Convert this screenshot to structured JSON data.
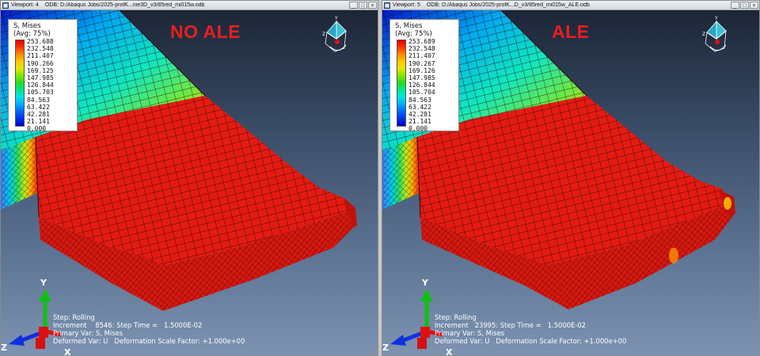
{
  "viewports": [
    {
      "title": "Viewport: 4",
      "odb": "ODB: D:/Abaqus Jobs/2025-profK...nie3D_v3/85red_mi015w.odb",
      "overlay_label": "NO ALE",
      "legend": {
        "title": "S, Mises",
        "avg": "(Avg: 75%)",
        "values": [
          "253.688",
          "232.548",
          "211.407",
          "190.266",
          "169.125",
          "147.985",
          "126.844",
          "105.703",
          "84.563",
          "63.422",
          "42.281",
          "21.141",
          "0.000"
        ]
      },
      "info": {
        "step": "Step: Rolling",
        "increment": "Increment    8546: Step Time =   1.5000E-02",
        "primary_var": "Primary Var: S, Mises",
        "deformed_var": "Deformed Var: U   Deformation Scale Factor: +1.000e+00"
      }
    },
    {
      "title": "Viewport: 5",
      "odb": "ODB: D:/Abaqus Jobs/2025-profK...D_v3/85red_mi015w_ALE.odb",
      "overlay_label": "ALE",
      "legend": {
        "title": "S, Mises",
        "avg": "(Avg: 75%)",
        "values": [
          "253.689",
          "232.548",
          "211.407",
          "190.267",
          "169.126",
          "147.985",
          "126.844",
          "105.704",
          "84.563",
          "63.422",
          "42.281",
          "21.141",
          "0.000"
        ]
      },
      "info": {
        "step": "Step: Rolling",
        "increment": "Increment   23995: Step Time =   1.5000E-02",
        "primary_var": "Primary Var: S, Mises",
        "deformed_var": "Deformed Var: U   Deformation Scale Factor: +1.000e+00"
      }
    }
  ],
  "titlebar_buttons": [
    "_",
    "□",
    "×"
  ],
  "triad": {
    "x": "X",
    "y": "Y",
    "z": "Z"
  },
  "icons": {
    "viewport": "viewport-icon",
    "minimize": "minimize-icon",
    "maximize": "maximize-icon",
    "close": "close-icon",
    "small_triad": "view-triad-icon",
    "axis_triad": "axis-triad-icon"
  },
  "colors": {
    "title_red": "#e81e1e",
    "mesh_red": "#e41b13",
    "background_top": "#1c2536",
    "background_bottom": "#7d93b1",
    "axis_x": "#e01010",
    "axis_y": "#10c010",
    "axis_z": "#1030e0"
  }
}
